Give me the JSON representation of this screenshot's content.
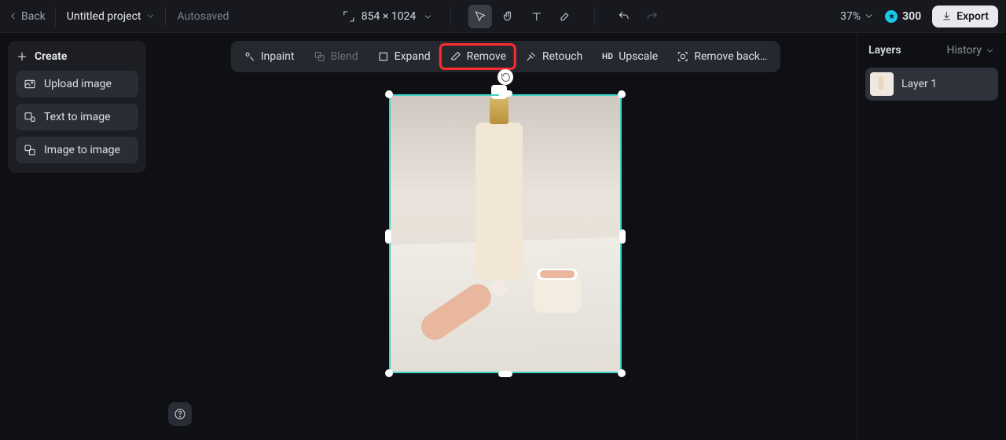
{
  "topbar": {
    "back": "Back",
    "project": "Untitled project",
    "autosaved": "Autosaved",
    "dimensions": "854 × 1024",
    "zoom": "37%",
    "credits": "300",
    "export": "Export"
  },
  "toolbar": {
    "cursor_active": true
  },
  "actions": {
    "inpaint": "Inpaint",
    "blend": "Blend",
    "expand": "Expand",
    "remove": "Remove",
    "retouch": "Retouch",
    "upscale": "Upscale",
    "remove_bg": "Remove back…"
  },
  "create": {
    "title": "Create",
    "upload": "Upload image",
    "text_to_image": "Text to image",
    "image_to_image": "Image to image"
  },
  "layers": {
    "tab": "Layers",
    "history": "History",
    "items": [
      {
        "label": "Layer 1"
      }
    ]
  }
}
